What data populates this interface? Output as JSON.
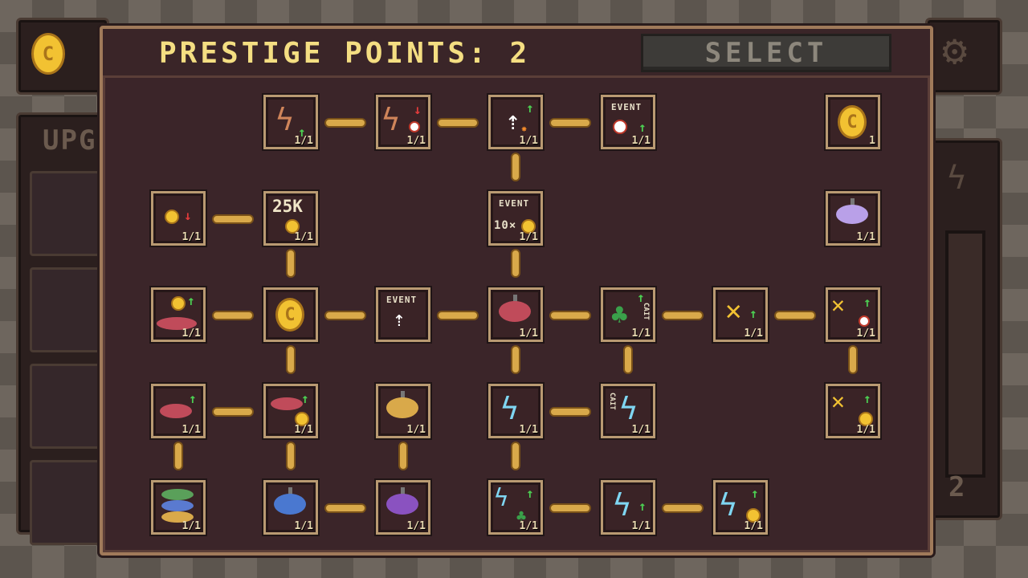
{
  "background": {
    "upgrades_title": "UPG",
    "side_counter": "2"
  },
  "header": {
    "title": "PRESTIGE POINTS: 2",
    "select_label": "SELECT"
  },
  "icon_text": {
    "event": "EVENT",
    "price_25k": "25K",
    "multiplier": "10×",
    "cait": "CAIT",
    "coin_letter": "C"
  },
  "nodes": {
    "r1c2": {
      "count": "1/1",
      "icon": "bolt-up-icon"
    },
    "r1c3": {
      "count": "1/1",
      "icon": "bolt-cooldown-down-icon"
    },
    "r1c4": {
      "count": "1/1",
      "icon": "pointer-spark-up-icon"
    },
    "r1c5": {
      "count": "1/1",
      "icon": "event-timer-up-icon"
    },
    "r1c8": {
      "count": "1",
      "icon": "coin-icon"
    },
    "r2c1": {
      "count": "1/1",
      "icon": "coin-down-icon"
    },
    "r2c2": {
      "count": "1/1",
      "icon": "25k-coin-icon"
    },
    "r2c4": {
      "count": "1/1",
      "icon": "event-10x-coin-icon"
    },
    "r2c8": {
      "count": "1/1",
      "icon": "purple-top-icon"
    },
    "r3c1": {
      "count": "1/1",
      "icon": "tops-coin-up-icon"
    },
    "r3c2": {
      "count": "",
      "icon": "coin-icon"
    },
    "r3c3": {
      "count": "",
      "icon": "event-pointer-icon"
    },
    "r3c4": {
      "count": "1/1",
      "icon": "red-top-icon"
    },
    "r3c5": {
      "count": "1/1",
      "icon": "clover-cait-up-icon"
    },
    "r3c6": {
      "count": "1/1",
      "icon": "x-up-icon"
    },
    "r3c7": {
      "count": "1/1",
      "icon": "x-up-timer-icon"
    },
    "r4c1": {
      "count": "1/1",
      "icon": "top-up-icon"
    },
    "r4c2": {
      "count": "1/1",
      "icon": "top-up-coin-icon"
    },
    "r4c3": {
      "count": "1/1",
      "icon": "yellow-top-icon"
    },
    "r4c4": {
      "count": "1/1",
      "icon": "lightning-icon"
    },
    "r4c5": {
      "count": "1/1",
      "icon": "cait-lightning-icon"
    },
    "r4c7": {
      "count": "1/1",
      "icon": "x-up-coin-icon"
    },
    "r5c1": {
      "count": "1/1",
      "icon": "multi-tops-icon"
    },
    "r5c2": {
      "count": "1/1",
      "icon": "blue-top-icon"
    },
    "r5c3": {
      "count": "1/1",
      "icon": "purple-top-icon"
    },
    "r5c4": {
      "count": "1/1",
      "icon": "lightning-clover-up-icon"
    },
    "r5c5": {
      "count": "1/1",
      "icon": "lightning-up-icon"
    },
    "r5c6": {
      "count": "1/1",
      "icon": "lightning-up-coin-icon"
    }
  },
  "colors": {
    "panel_bg": "#3b2529",
    "title": "#f4de82",
    "connector": "#d9a94a",
    "node_border": "#b99a72",
    "up_arrow": "#4ccf52",
    "down_arrow": "#e23b3b"
  }
}
